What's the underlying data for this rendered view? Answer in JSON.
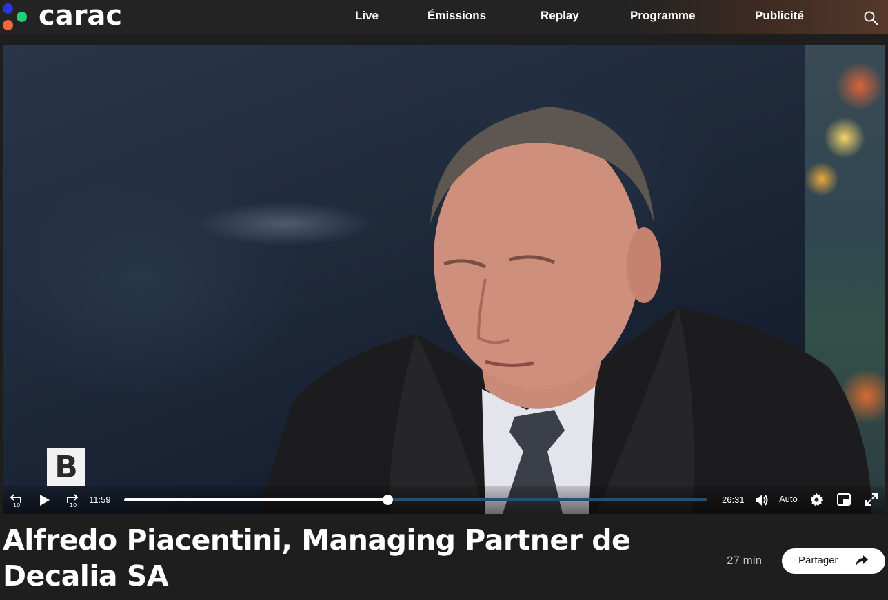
{
  "header": {
    "logo_text": "carac",
    "nav": [
      {
        "label": "Live"
      },
      {
        "label": "Émissions"
      },
      {
        "label": "Replay"
      },
      {
        "label": "Programme"
      },
      {
        "label": "Publicité"
      }
    ],
    "search_icon": "search-icon"
  },
  "player": {
    "watermark_letter": "B",
    "current_time": "11:59",
    "duration_time": "26:31",
    "progress_fraction": 0.452,
    "quality": "Auto",
    "icons": [
      "rewind-10-icon",
      "play-icon",
      "forward-10-icon",
      "volume-icon",
      "settings-gear-icon",
      "picture-in-picture-icon",
      "fullscreen-icon"
    ]
  },
  "episode": {
    "title": "Alfredo Piacentini, Managing Partner de Decalia SA",
    "duration": "27 min",
    "share_label": "Partager"
  },
  "colors": {
    "background": "#1e1e1e",
    "progress_track": "#29506a",
    "logo_blue": "#2a35e0",
    "logo_green": "#1fcf7a",
    "logo_orange": "#f0683a"
  }
}
